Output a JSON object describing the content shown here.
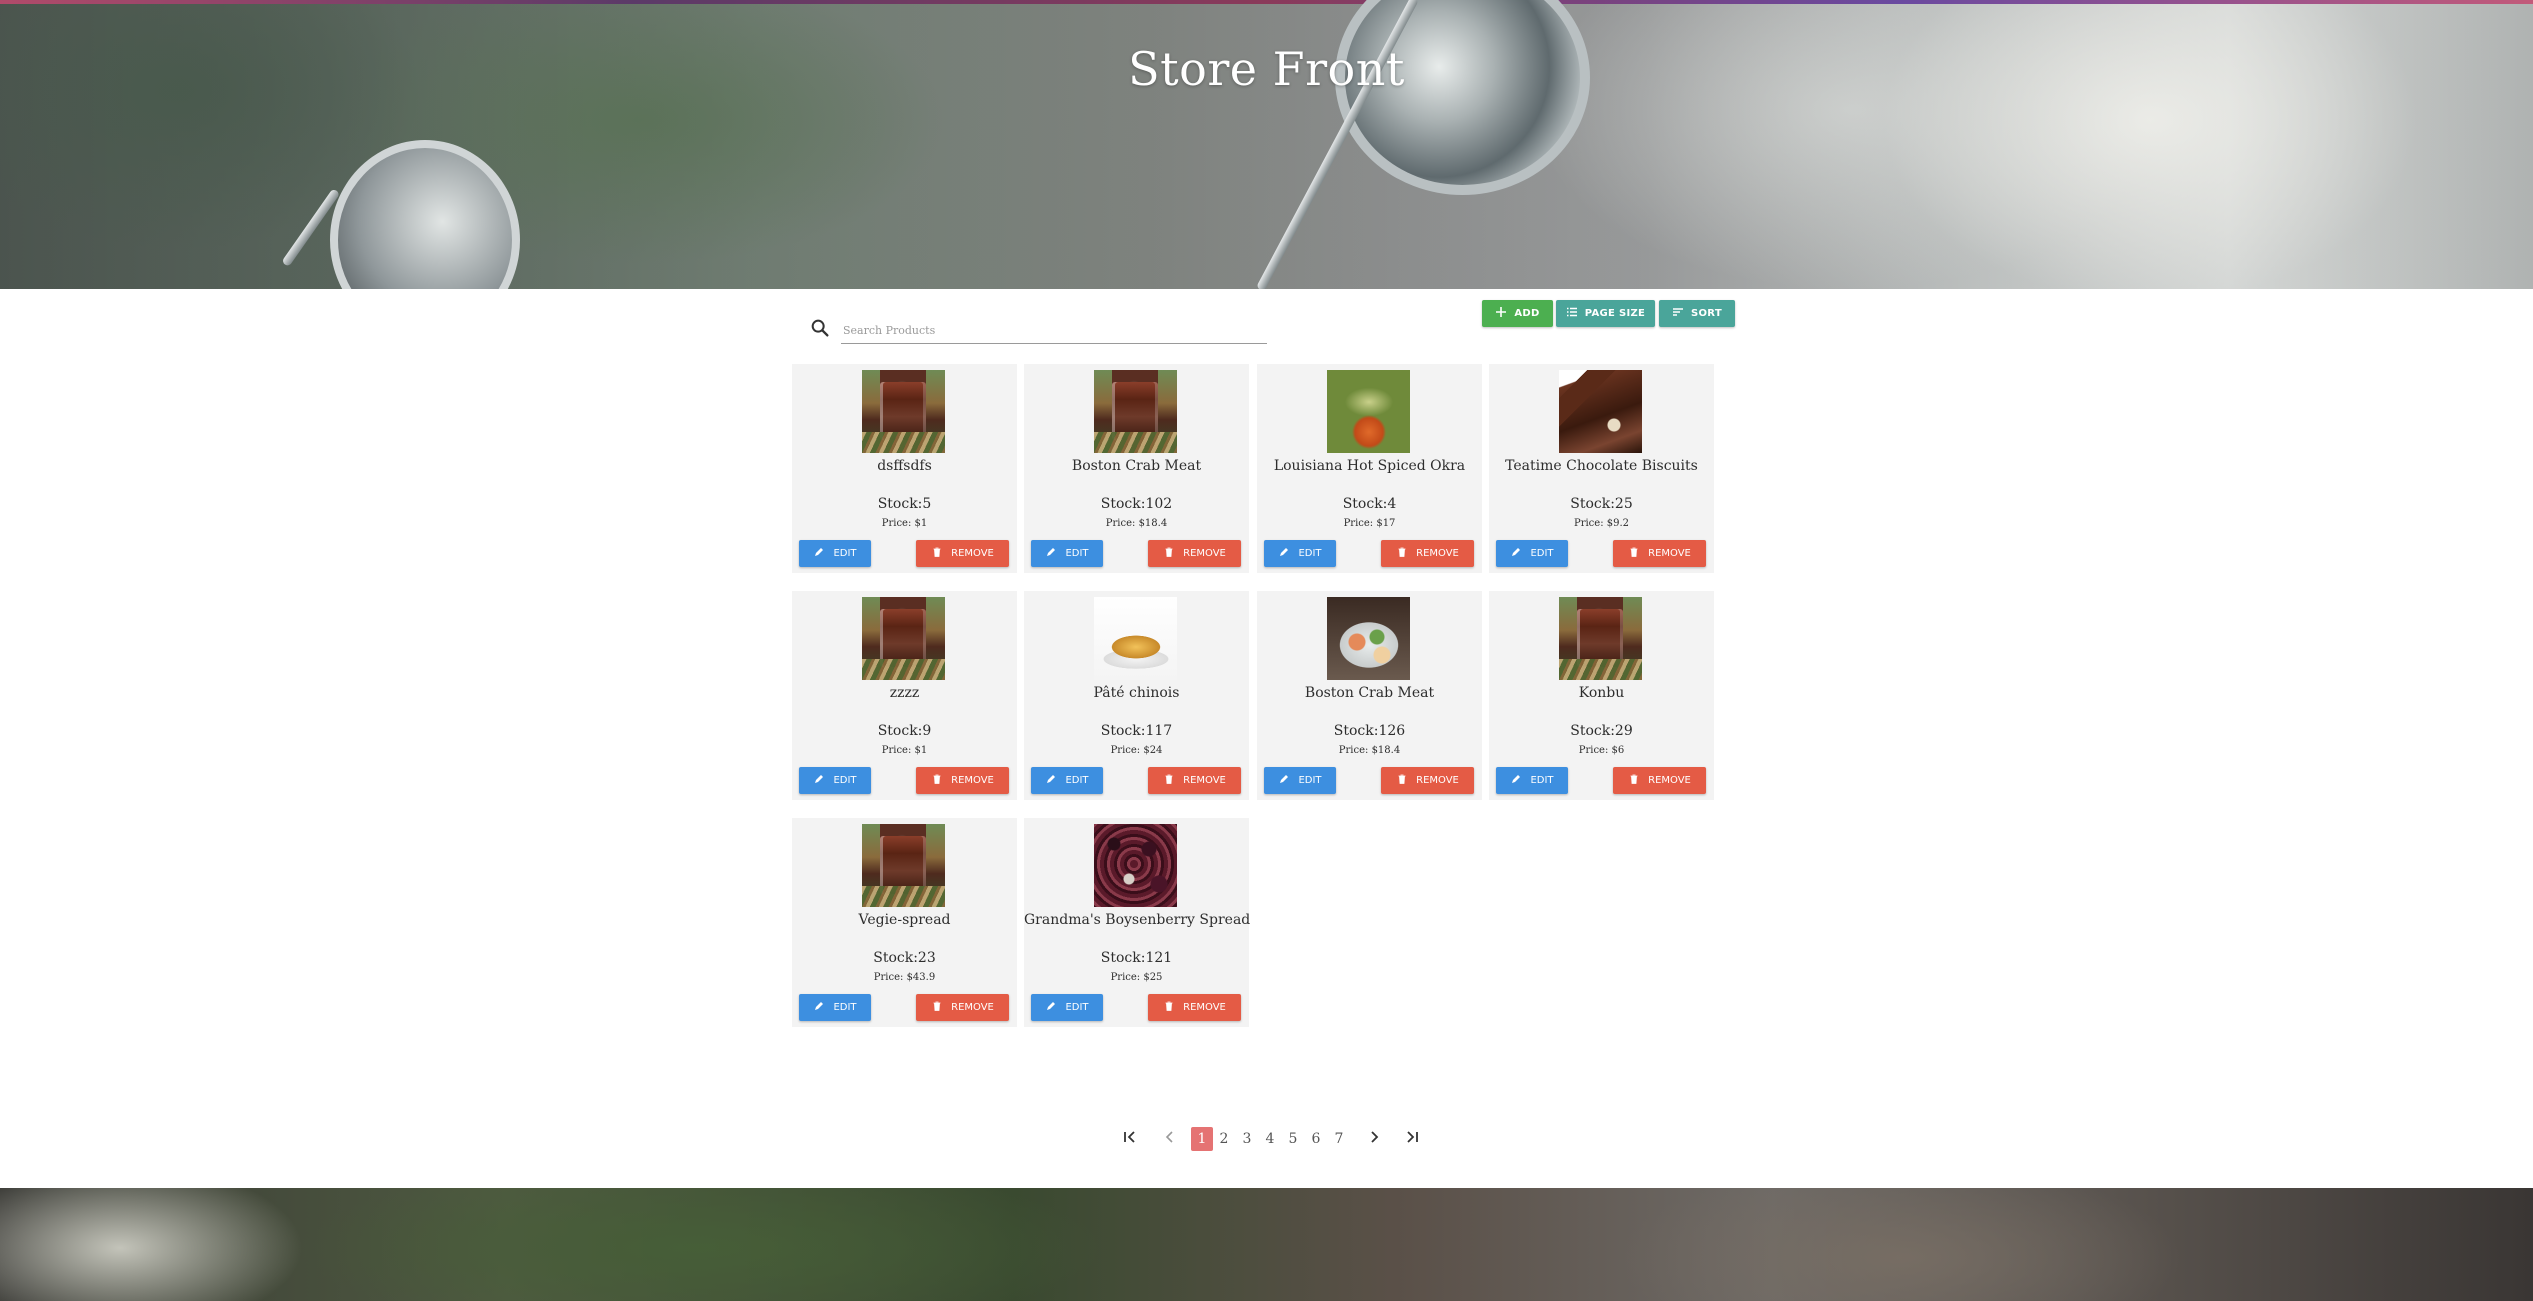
{
  "header": {
    "title": "Store Front"
  },
  "search": {
    "placeholder": "Search Products",
    "value": ""
  },
  "toolbar": {
    "add_label": "ADD",
    "page_size_label": "PAGE SIZE",
    "sort_label": "SORT"
  },
  "card_buttons": {
    "edit_label": "EDIT",
    "remove_label": "REMOVE"
  },
  "products": [
    {
      "name": "dsffsdfs",
      "stock": "Stock:5",
      "price": "Price: $1",
      "image": "coffee-glass"
    },
    {
      "name": "Boston Crab Meat",
      "stock": "Stock:102",
      "price": "Price: $18.4",
      "image": "coffee-glass"
    },
    {
      "name": "Louisiana Hot Spiced Okra",
      "stock": "Stock:4",
      "price": "Price: $17",
      "image": "okra-dish"
    },
    {
      "name": "Teatime Chocolate Biscuits",
      "stock": "Stock:25",
      "price": "Price: $9.2",
      "image": "chocolate"
    },
    {
      "name": "zzzz",
      "stock": "Stock:9",
      "price": "Price: $1",
      "image": "coffee-glass"
    },
    {
      "name": "Pâté chinois",
      "stock": "Stock:117",
      "price": "Price: $24",
      "image": "pate-plate"
    },
    {
      "name": "Boston Crab Meat",
      "stock": "Stock:126",
      "price": "Price: $18.4",
      "image": "crab-salad"
    },
    {
      "name": "Konbu",
      "stock": "Stock:29",
      "price": "Price: $6",
      "image": "coffee-glass"
    },
    {
      "name": "Vegie-spread",
      "stock": "Stock:23",
      "price": "Price: $43.9",
      "image": "coffee-glass"
    },
    {
      "name": "Grandma's Boysenberry Spread",
      "stock": "Stock:121",
      "price": "Price: $25",
      "image": "berries"
    }
  ],
  "pagination": {
    "pages": [
      "1",
      "2",
      "3",
      "4",
      "5",
      "6",
      "7"
    ],
    "current": "1",
    "active_color": "#e57373"
  },
  "colors": {
    "add": "#4caf50",
    "teal": "#4aa59a",
    "edit": "#3d8fe0",
    "remove": "#e45b45",
    "card_bg": "#f3f3f3"
  },
  "icons": {
    "search": "search-icon",
    "add": "plus-icon",
    "page_size": "list-icon",
    "sort": "sort-icon",
    "edit": "pencil-icon",
    "remove": "trash-icon",
    "first": "first-page-icon",
    "prev": "chevron-left-icon",
    "next": "chevron-right-icon",
    "last": "last-page-icon"
  }
}
